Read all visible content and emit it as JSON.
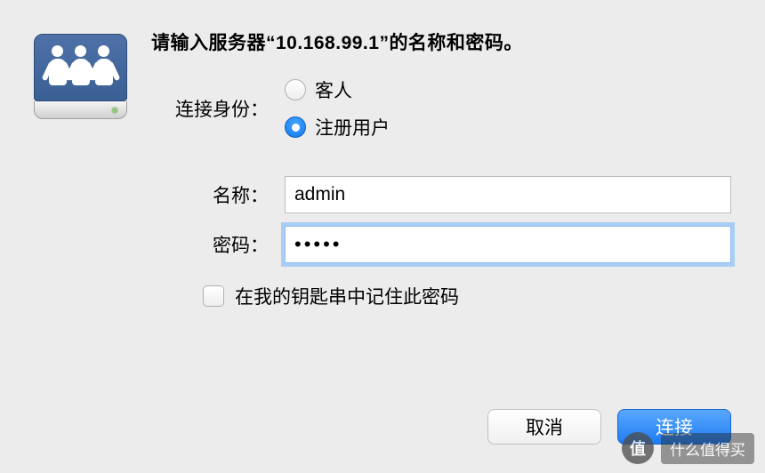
{
  "server_ip": "10.168.99.1",
  "title_prefix": "请输入服务器“",
  "title_suffix": "”的名称和密码。",
  "labels": {
    "connect_as": "连接身份：",
    "name": "名称：",
    "password": "密码："
  },
  "radio": {
    "guest": "客人",
    "registered": "注册用户",
    "selected": "registered"
  },
  "fields": {
    "name_value": "admin",
    "password_value": "•••••"
  },
  "checkbox": {
    "remember_label": "在我的钥匙串中记住此密码",
    "checked": false
  },
  "buttons": {
    "cancel": "取消",
    "connect": "连接"
  },
  "watermark": {
    "badge": "值",
    "text": "什么值得买"
  }
}
